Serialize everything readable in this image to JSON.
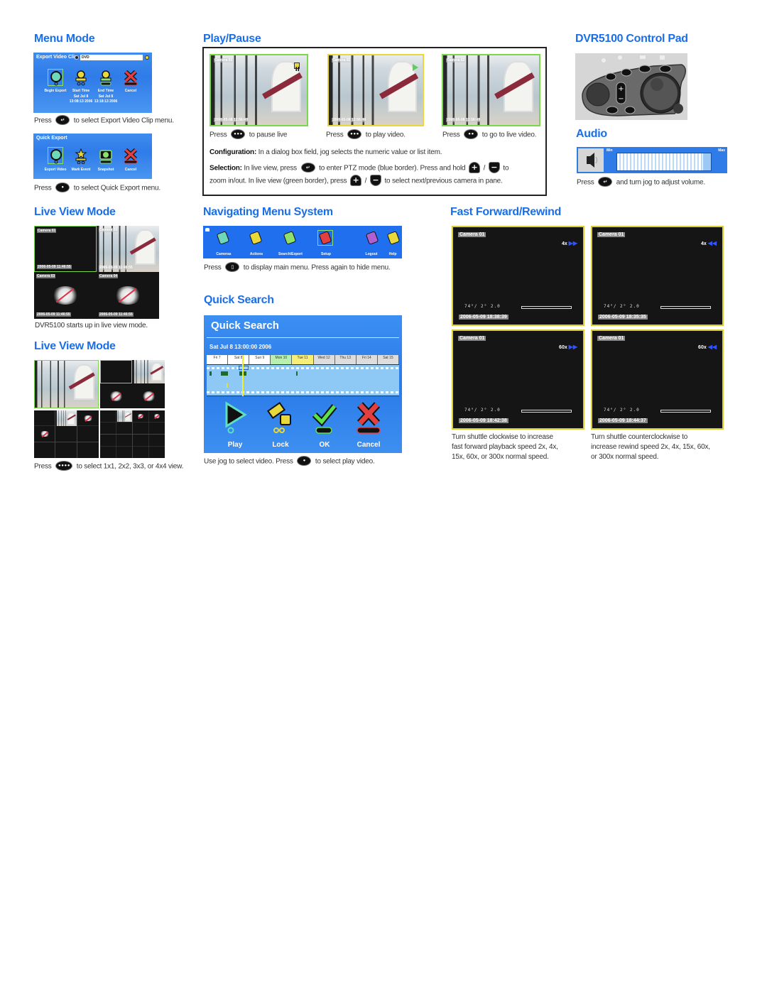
{
  "sections": {
    "menu_mode": {
      "title": "Menu Mode",
      "export_screen": {
        "title": "Export Video Clip",
        "field_value": "DVD",
        "items": [
          {
            "label": "Begin Export",
            "value": ""
          },
          {
            "label": "Start Time",
            "value": "Sat Jul 8 13:08:13 2006"
          },
          {
            "label": "End Time",
            "value": "Sat Jul 8 13:18:13 2006"
          },
          {
            "label": "Cancel",
            "value": ""
          }
        ]
      },
      "export_caption": {
        "pre": "Press",
        "post": "to select Export Video Clip menu.",
        "button_icon": "enter-button-icon"
      },
      "quick_export_screen": {
        "title": "Quick Export",
        "items": [
          {
            "label": "Export Video"
          },
          {
            "label": "Mark Event"
          },
          {
            "label": "Snapshot"
          },
          {
            "label": "Cancel"
          }
        ]
      },
      "quick_export_caption": {
        "pre": "Press",
        "post": "to select Quick Export menu.",
        "button_icon": "one-dot-button-icon"
      }
    },
    "play_pause": {
      "title": "Play/Pause",
      "frames": [
        {
          "camera": "Camera 02",
          "timestamp": "2006-05-08 12:56:48",
          "status_icon": "pause-icon",
          "border": "#7ad84a",
          "caption_pre": "Press",
          "caption_post": "to pause live",
          "button_icon": "three-dot-button-icon"
        },
        {
          "camera": "Camera 02",
          "timestamp": "2006-05-08 12:56:48",
          "status_icon": "play-icon",
          "border": "#e8d83a",
          "caption_pre": "Press",
          "caption_post": "to play video.",
          "button_icon": "three-dot-button-icon"
        },
        {
          "camera": "Camera 02",
          "timestamp": "2006-05-08 12:56:48",
          "status_icon": "",
          "border": "#7ad84a",
          "caption_pre": "Press",
          "caption_post": "to go to live video.",
          "button_icon": "two-dot-button-icon"
        }
      ],
      "configuration": {
        "label": "Configuration:",
        "text": "In a dialog box field, jog selects the numeric value or list item."
      },
      "selection": {
        "label": "Selection:",
        "part1": "In live view, press",
        "part2": "to enter PTZ mode (blue border). Press and hold",
        "slash": "/",
        "part3": "to",
        "part4": "zoom in/out. In live view (green border), press",
        "part5": "to select next/previous camera in pane."
      }
    },
    "control_pad": {
      "title": "DVR5100 Control Pad"
    },
    "audio": {
      "title": "Audio",
      "min_label": "Min",
      "max_label": "Max",
      "volume_level": 0.92,
      "caption_pre": "Press",
      "caption_post": "and turn jog to adjust volume."
    },
    "live_view_1": {
      "title": "Live View Mode",
      "cameras": [
        {
          "name": "Camera 01",
          "timestamp": "2006-05-09 11:46:55",
          "type": "black"
        },
        {
          "name": "Camera 02",
          "timestamp": "2006-05-09 11:46:55",
          "type": "corridor"
        },
        {
          "name": "Camera 03",
          "timestamp": "2006-05-09 11:46:55",
          "type": "no-signal"
        },
        {
          "name": "Camera 04",
          "timestamp": "2006-05-09 11:46:55",
          "type": "no-signal"
        }
      ],
      "caption": "DVR5100 starts up in live view mode."
    },
    "live_view_2": {
      "title": "Live View Mode",
      "caption_pre": "Press",
      "caption_post": "to select 1x1, 2x2, 3x3, or 4x4 view."
    },
    "navigating": {
      "title": "Navigating Menu System",
      "menu_items": [
        {
          "label": "Cameras"
        },
        {
          "label": "Actions"
        },
        {
          "label": "Search/Export"
        },
        {
          "label": "Setup"
        },
        {
          "label": "Logout"
        },
        {
          "label": "Help"
        }
      ],
      "caption_pre": "Press",
      "caption_post": "to display main menu. Press again to hide menu."
    },
    "quick_search": {
      "title": "Quick Search",
      "screen_title": "Quick Search",
      "date": "Sat Jul 8 13:00:00 2006",
      "days": [
        {
          "label": "Fri 7",
          "color": "#ffffff"
        },
        {
          "label": "Sat 8",
          "color": "#ffffff"
        },
        {
          "label": "Sun 9",
          "color": "#ffffff"
        },
        {
          "label": "Mon 10",
          "color": "#b8f0b0"
        },
        {
          "label": "Tue 11",
          "color": "#f6ee78"
        },
        {
          "label": "Wed 12",
          "color": "#dddddd"
        },
        {
          "label": "Thu 13",
          "color": "#dddddd"
        },
        {
          "label": "Fri 14",
          "color": "#dddddd"
        },
        {
          "label": "Sat 15",
          "color": "#dddddd"
        }
      ],
      "actions": [
        {
          "label": "Play",
          "icon": "play-icon"
        },
        {
          "label": "Lock",
          "icon": "lock-icon"
        },
        {
          "label": "OK",
          "icon": "check-icon"
        },
        {
          "label": "Cancel",
          "icon": "cancel-icon"
        }
      ],
      "caption_pre": "Use jog to select video. Press",
      "caption_post": "to select play video."
    },
    "ff_rewind": {
      "title": "Fast Forward/Rewind",
      "frames": [
        {
          "camera": "Camera 01",
          "speed": "4x",
          "direction": "forward",
          "meta": "74°/  2°   2.0",
          "timestamp": "2006-05-09 18:38:39"
        },
        {
          "camera": "Camera 01",
          "speed": "4x",
          "direction": "rewind",
          "meta": "74°/  2°   2.0",
          "timestamp": "2006-05-09 18:35:35"
        },
        {
          "camera": "Camera 01",
          "speed": "60x",
          "direction": "forward",
          "meta": "74°/  2°   2.0",
          "timestamp": "2006-05-09 18:42:38"
        },
        {
          "camera": "Camera 01",
          "speed": "60x",
          "direction": "rewind",
          "meta": "74°/  2°   2.0",
          "timestamp": "2006-05-09 18:44:37"
        }
      ],
      "captions": [
        "Turn shuttle clockwise to increase\nfast forward playback speed 2x, 4x,\n15x, 60x, or 300x normal speed.",
        "Turn shuttle counterclockwise to\nincrease rewind speed 2x, 4x, 15x, 60x,\nor 300x normal speed."
      ]
    }
  },
  "glyphs": {
    "enter": "↵",
    "one_dot": "•",
    "two_dot": "••",
    "three_dot": "•••",
    "four_dot": "••••",
    "menu": "▯",
    "plus": "+",
    "minus": "−",
    "ff": "▶▶",
    "rw": "◀◀"
  }
}
